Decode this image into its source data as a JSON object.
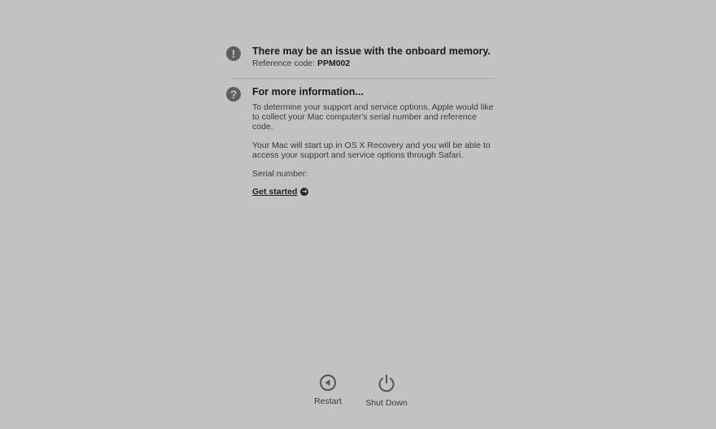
{
  "issue": {
    "icon": "exclamation-icon",
    "headline": "There may be an issue with the onboard memory.",
    "ref_label": "Reference code: ",
    "ref_code": "PPM002"
  },
  "info": {
    "icon": "question-icon",
    "heading": "For more information...",
    "para1": "To determine your support and service options, Apple would like to collect your Mac computer's serial number and reference code.",
    "para2": "Your Mac will start up in OS X Recovery and you will be able to access your support and service options through Safari.",
    "serial_label": "Serial number:",
    "get_started": "Get started"
  },
  "actions": {
    "restart_label": "Restart",
    "shutdown_label": "Shut Down"
  }
}
